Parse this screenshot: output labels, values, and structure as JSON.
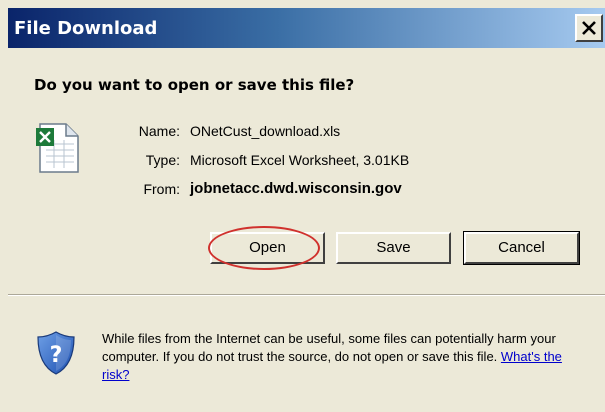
{
  "window": {
    "title": "File Download",
    "close_label": "Close"
  },
  "prompt": {
    "question": "Do you want to open or save this file?"
  },
  "file": {
    "icon": "excel-file-icon",
    "name_label": "Name:",
    "name_value": "ONetCust_download.xls",
    "type_label": "Type:",
    "type_value": "Microsoft Excel Worksheet, 3.01KB",
    "from_label": "From:",
    "from_value": "jobnetacc.dwd.wisconsin.gov"
  },
  "buttons": {
    "open": "Open",
    "save": "Save",
    "cancel": "Cancel"
  },
  "warning": {
    "icon": "shield-question-icon",
    "text": "While files from the Internet can be useful, some files can potentially harm your computer. If you do not trust the source, do not open or save this file.",
    "link": "What's the risk?"
  },
  "colors": {
    "title_bar": "#0a246a",
    "dialog_bg": "#ece9d8",
    "highlight": "#d0312d",
    "link": "#0000cc"
  }
}
